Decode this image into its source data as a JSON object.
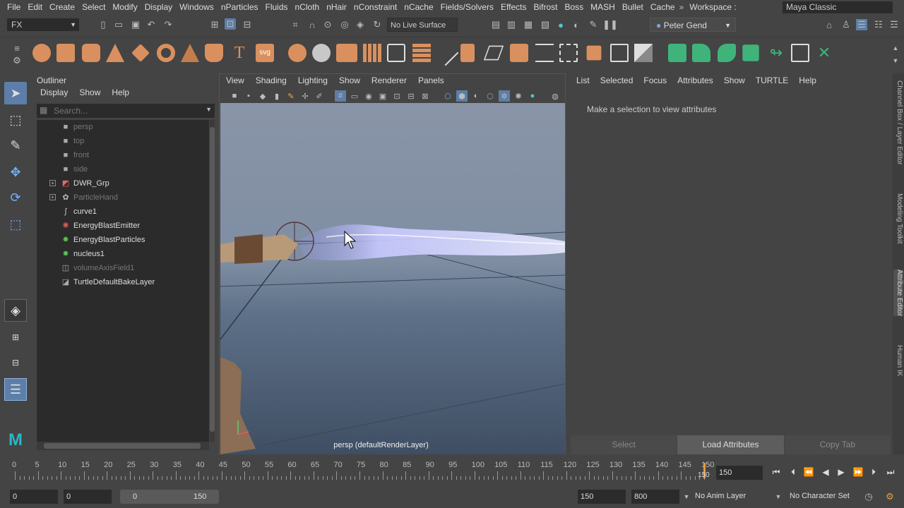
{
  "menubar": {
    "items": [
      "File",
      "Edit",
      "Create",
      "Select",
      "Modify",
      "Display",
      "Windows",
      "nParticles",
      "Fluids",
      "nCloth",
      "nHair",
      "nConstraint",
      "nCache",
      "Fields/Solvers",
      "Effects",
      "Bifrost",
      "Boss",
      "MASH",
      "Bullet",
      "Cache"
    ],
    "workspace_label": "Workspace :",
    "workspace_value": "Maya Classic"
  },
  "statusline": {
    "menuset": "FX",
    "live_surface": "No Live Surface",
    "user": "Peter Gend"
  },
  "outliner": {
    "title": "Outliner",
    "menu": [
      "Display",
      "Show",
      "Help"
    ],
    "search_placeholder": "Search...",
    "items": [
      {
        "label": "persp",
        "icon": "camera-icon",
        "dim": true,
        "expand": false
      },
      {
        "label": "top",
        "icon": "camera-icon",
        "dim": true,
        "expand": false
      },
      {
        "label": "front",
        "icon": "camera-icon",
        "dim": true,
        "expand": false
      },
      {
        "label": "side",
        "icon": "camera-icon",
        "dim": true,
        "expand": false
      },
      {
        "label": "DWR_Grp",
        "icon": "group-icon",
        "dim": false,
        "expand": true
      },
      {
        "label": "ParticleHand",
        "icon": "particle-hand-icon",
        "dim": true,
        "expand": true
      },
      {
        "label": "curve1",
        "icon": "curve-icon",
        "dim": false,
        "expand": false
      },
      {
        "label": "EnergyBlastEmitter",
        "icon": "emitter-icon",
        "dim": false,
        "expand": false
      },
      {
        "label": "EnergyBlastParticles",
        "icon": "particles-icon",
        "dim": false,
        "expand": false
      },
      {
        "label": "nucleus1",
        "icon": "nucleus-icon",
        "dim": false,
        "expand": false
      },
      {
        "label": "volumeAxisField1",
        "icon": "field-icon",
        "dim": true,
        "expand": false
      },
      {
        "label": "TurtleDefaultBakeLayer",
        "icon": "bake-layer-icon",
        "dim": false,
        "expand": false
      }
    ]
  },
  "viewport": {
    "menu": [
      "View",
      "Shading",
      "Lighting",
      "Show",
      "Renderer",
      "Panels"
    ],
    "label": "persp (defaultRenderLayer)"
  },
  "attribute_editor": {
    "menu": [
      "List",
      "Selected",
      "Focus",
      "Attributes",
      "Show",
      "TURTLE",
      "Help"
    ],
    "message": "Make a selection to view attributes",
    "buttons": [
      "Select",
      "Load Attributes",
      "Copy Tab"
    ]
  },
  "side_tabs": [
    "Channel Box / Layer Editor",
    "Modeling Toolkit",
    "Attribute Editor",
    "Human IK"
  ],
  "timeline": {
    "ticks": [
      0,
      5,
      10,
      15,
      20,
      25,
      30,
      35,
      40,
      45,
      50,
      55,
      60,
      65,
      70,
      75,
      80,
      85,
      90,
      95,
      100,
      105,
      110,
      115,
      120,
      125,
      130,
      135,
      140,
      145,
      150
    ],
    "current_frame": "150",
    "playhead_label": "150"
  },
  "range": {
    "start": "0",
    "anim_start": "0",
    "slider_start": "0",
    "slider_end": "150",
    "anim_end": "150",
    "end": "800",
    "anim_layer": "No Anim Layer",
    "character_set": "No Character Set"
  }
}
